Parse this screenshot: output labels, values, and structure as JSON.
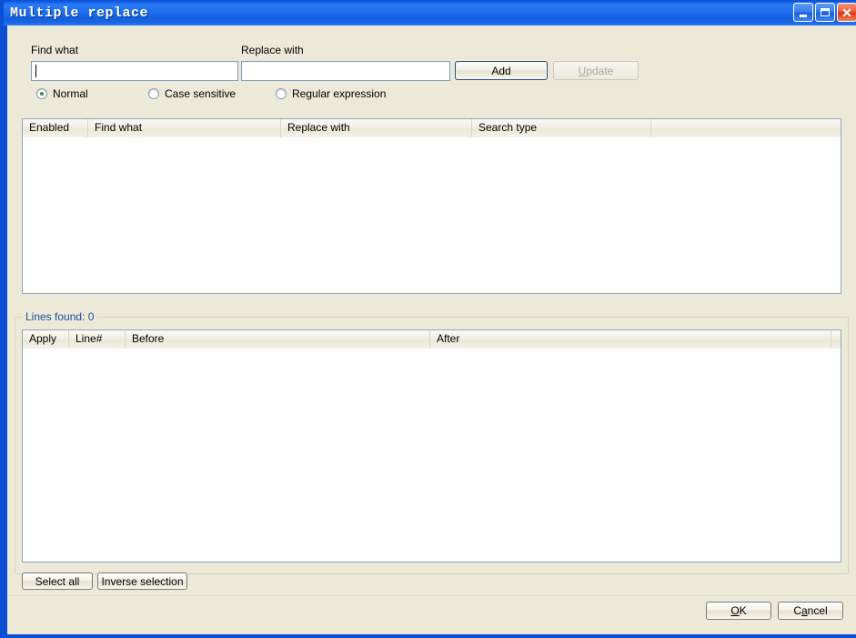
{
  "window": {
    "title": "Multiple replace",
    "controls": {
      "minimize": "minimize",
      "maximize": "maximize",
      "close": "close"
    }
  },
  "form": {
    "find_label": "Find what",
    "find_value": "",
    "find_placeholder": "",
    "replace_label": "Replace with",
    "replace_value": "",
    "replace_placeholder": "",
    "add_label": "Add",
    "update_label": "Update",
    "update_label_pre": "",
    "update_label_key": "U",
    "update_label_post": "pdate",
    "update_enabled": false
  },
  "search_modes": {
    "selected": "Normal",
    "options": [
      {
        "label": "Normal",
        "checked": true
      },
      {
        "label": "Case sensitive",
        "checked": false
      },
      {
        "label": "Regular expression",
        "checked": false
      }
    ]
  },
  "rules_list": {
    "columns": [
      "Enabled",
      "Find what",
      "Replace with",
      "Search type"
    ],
    "rows": []
  },
  "results_group": {
    "legend": "Lines found: 0",
    "lines_found": 0
  },
  "results_list": {
    "columns": [
      "Apply",
      "Line#",
      "Before",
      "After"
    ],
    "rows": []
  },
  "selection_buttons": {
    "select_all": "Select all",
    "inverse_selection": "Inverse selection"
  },
  "dialog_buttons": {
    "ok": "OK",
    "ok_key": "O",
    "ok_rest": "K",
    "cancel": "Cancel",
    "cancel_pre": "C",
    "cancel_key": "a",
    "cancel_post": "ncel"
  },
  "colors": {
    "titlebar_blue": "#1E6EEE",
    "dialog_face": "#ECE9D8",
    "field_border": "#7F9DB9",
    "list_border": "#8FA8BE",
    "legend_blue": "#1B4FA0",
    "radio_dot_green": "#3A8F35",
    "close_red": "#D83A12"
  }
}
